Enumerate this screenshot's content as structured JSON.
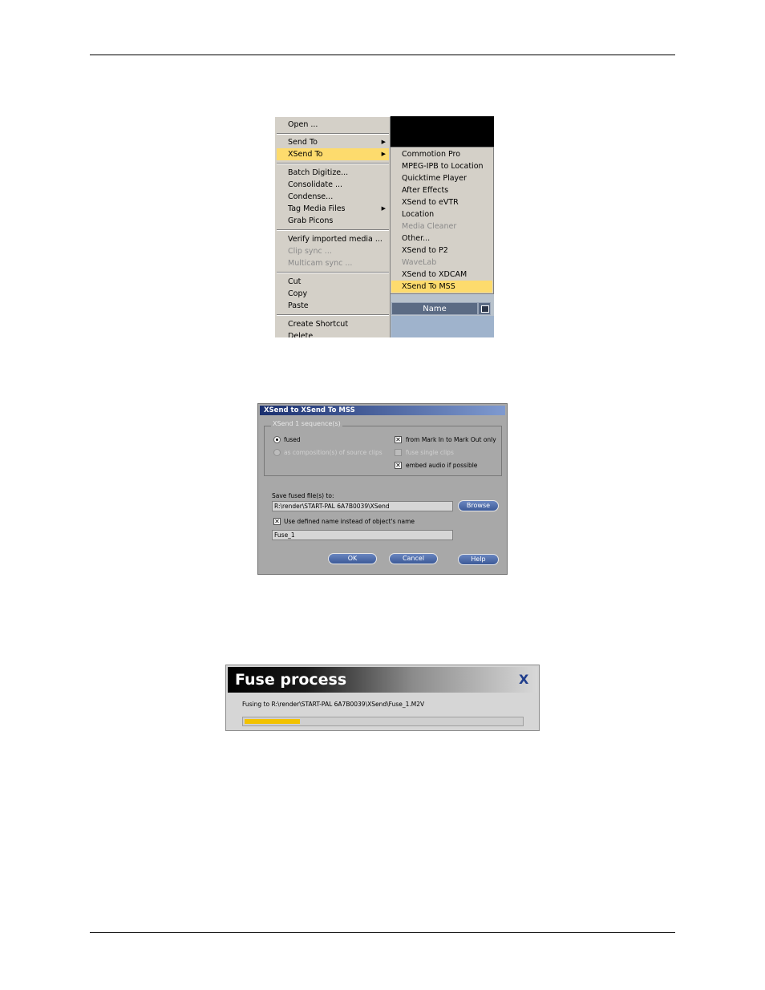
{
  "context_menu": {
    "items": [
      {
        "label": "Open ..."
      },
      {
        "label": "Send To"
      },
      {
        "label": "XSend To"
      },
      {
        "label": "Batch Digitize..."
      },
      {
        "label": "Consolidate ..."
      },
      {
        "label": "Condense..."
      },
      {
        "label": "Tag Media Files"
      },
      {
        "label": "Grab Picons"
      },
      {
        "label": "Verify imported media ..."
      },
      {
        "label": "Clip sync ..."
      },
      {
        "label": "Multicam sync ..."
      },
      {
        "label": "Cut"
      },
      {
        "label": "Copy"
      },
      {
        "label": "Paste"
      },
      {
        "label": "Create Shortcut"
      },
      {
        "label": "Delete"
      }
    ],
    "submenu": [
      {
        "label": "Commotion Pro"
      },
      {
        "label": "MPEG-IPB to Location"
      },
      {
        "label": "Quicktime Player"
      },
      {
        "label": "After Effects"
      },
      {
        "label": "XSend to eVTR"
      },
      {
        "label": "Location"
      },
      {
        "label": "Media Cleaner"
      },
      {
        "label": "Other..."
      },
      {
        "label": "XSend to P2"
      },
      {
        "label": "WaveLab"
      },
      {
        "label": "XSend to XDCAM"
      },
      {
        "label": "XSend To MSS"
      }
    ],
    "highlight_color": "#fddb6d",
    "bin_column_header": "Name"
  },
  "xsend_dialog": {
    "title": "XSend to XSend To MSS",
    "group_label": "XSend 1 sequence(s)",
    "radio_fused": "fused",
    "radio_composition": "as composition(s) of source clips",
    "chk_mark_in_out": "from Mark In to Mark Out only",
    "chk_fuse_single": "fuse single clips",
    "chk_embed_audio": "embed audio if possible",
    "save_label": "Save fused file(s) to:",
    "save_path": "R:\\render\\START-PAL 6A7B0039\\XSend",
    "browse_label": "Browse",
    "chk_user_name": "Use defined name instead of object's name",
    "name_value": "Fuse_1",
    "ok_label": "OK",
    "cancel_label": "Cancel",
    "help_label": "Help",
    "title_color": "#1a2f6e"
  },
  "fuse_process": {
    "title": "Fuse process",
    "close_glyph": "X",
    "status": "Fusing to R:\\render\\START-PAL 6A7B0039\\XSend\\Fuse_1.M2V",
    "progress_fraction": 0.2,
    "progress_color": "#f2c200"
  }
}
